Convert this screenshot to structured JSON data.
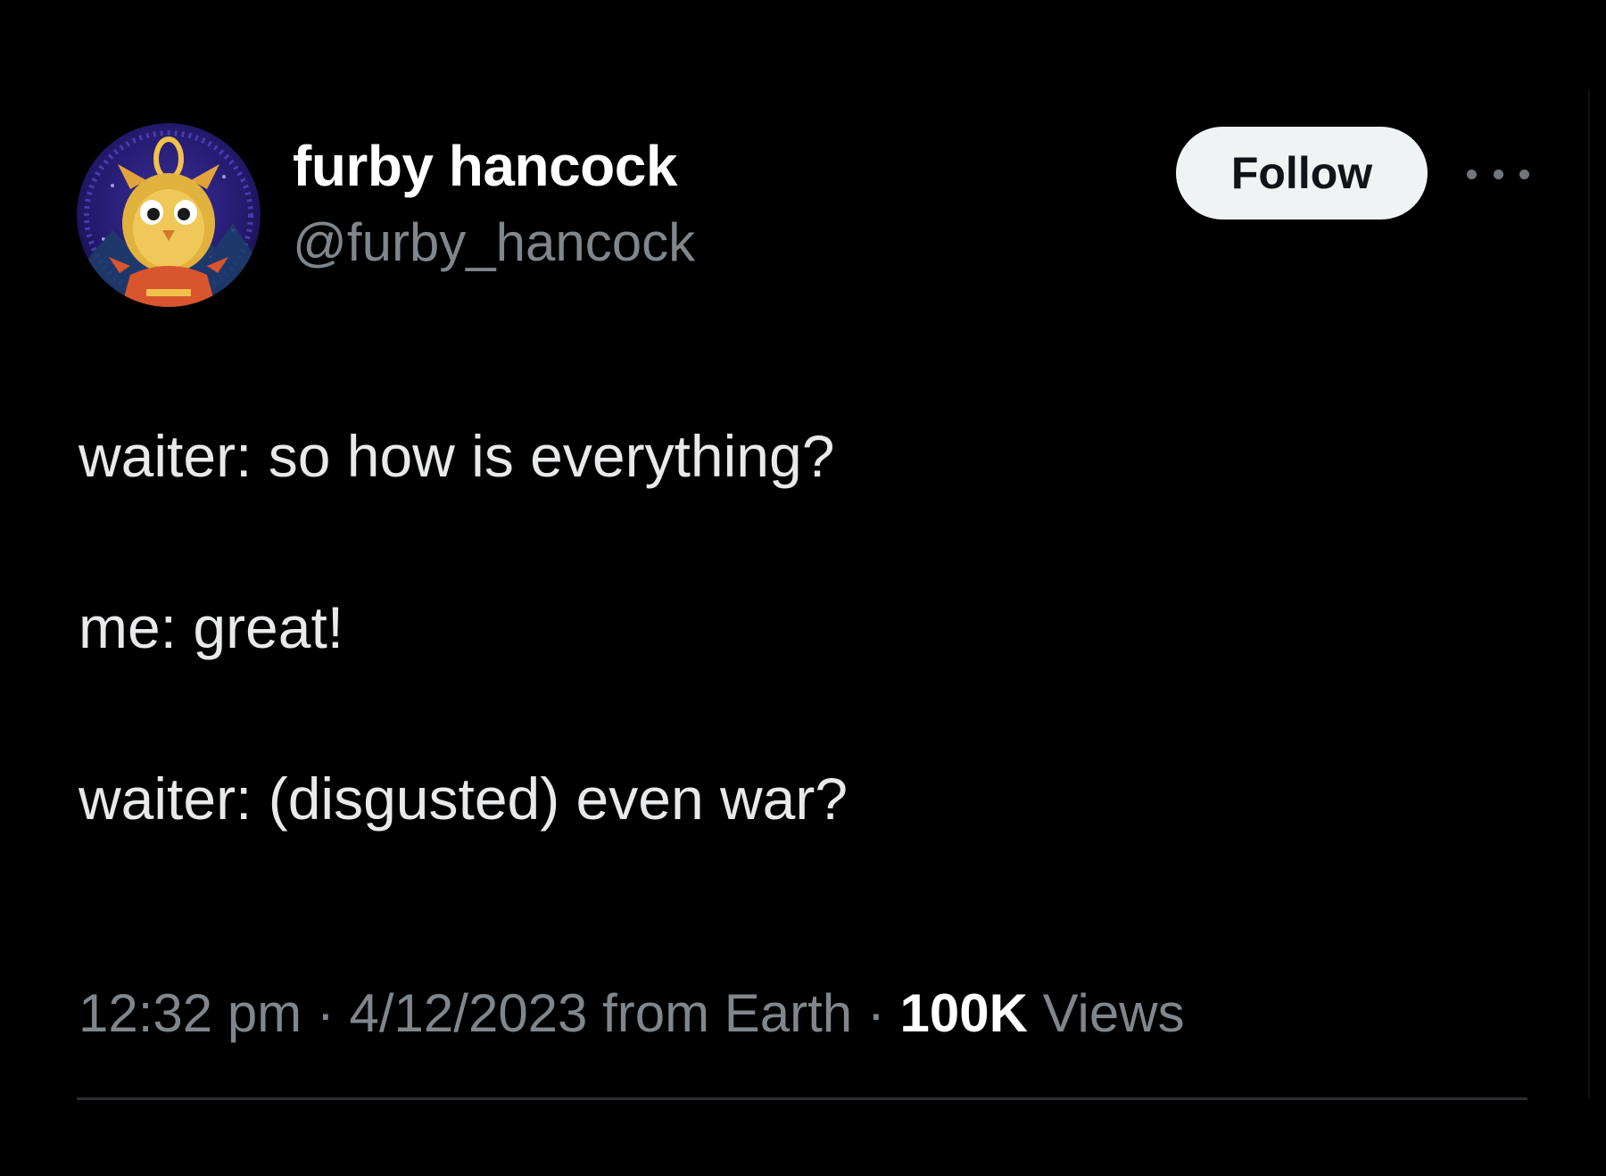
{
  "author": {
    "display_name": "furby hancock",
    "handle": "@furby_hancock",
    "avatar_icon": "furby-avatar-icon"
  },
  "actions": {
    "follow_label": "Follow",
    "more_icon": "more-dots-icon"
  },
  "tweet": {
    "lines": [
      "waiter: so how is everything?",
      "me: great!",
      "waiter: (disgusted) even war?"
    ]
  },
  "meta": {
    "time": "12:32 pm",
    "separator": " · ",
    "date_source": "4/12/2023 from Earth",
    "views_count": "100K",
    "views_label": "Views"
  },
  "colors": {
    "background": "#000000",
    "primary_text": "#e7e9ea",
    "secondary_text": "#7f868c",
    "follow_button_bg": "#eff3f4",
    "follow_button_text": "#0f1419",
    "divider": "#2a2d30"
  }
}
